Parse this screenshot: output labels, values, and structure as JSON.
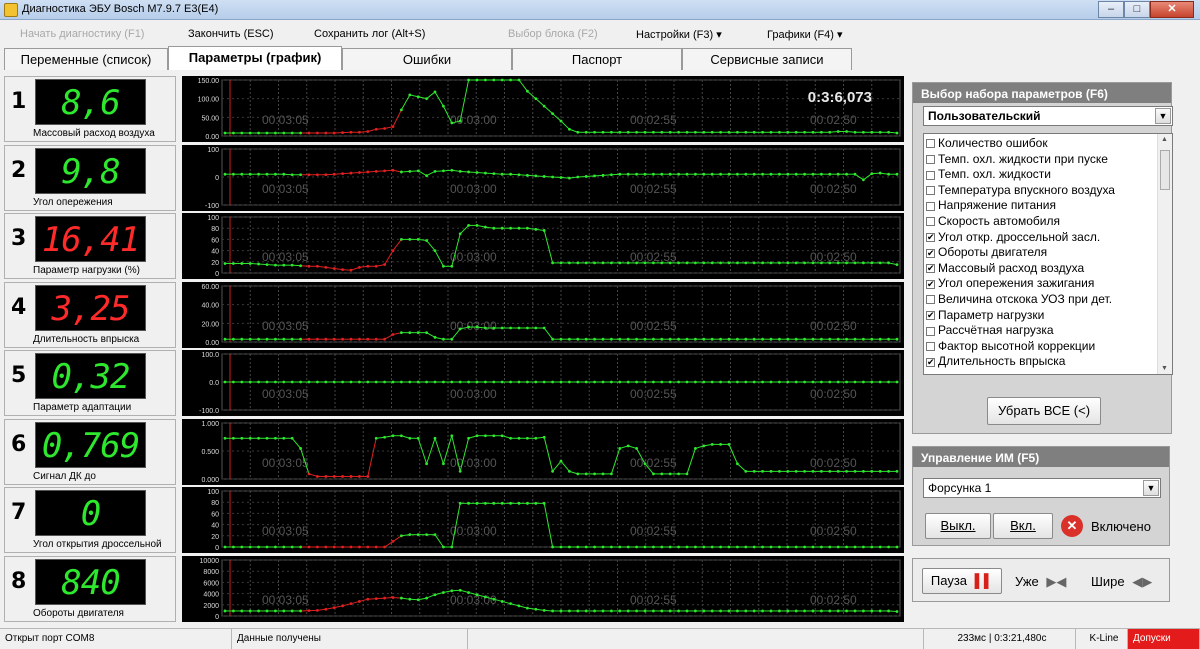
{
  "window": {
    "title": "Диагностика ЭБУ Bosch M7.9.7 E3(E4)",
    "min": "–",
    "max": "□",
    "close": "✕"
  },
  "menu": {
    "start": "Начать диагностику (F1)",
    "finish": "Закончить (ESC)",
    "save_log": "Сохранить лог (Alt+S)",
    "select_block": "Выбор блока (F2)",
    "settings": "Настройки (F3)",
    "graphs": "Графики (F4)"
  },
  "tabs": [
    "Переменные (список)",
    "Параметры (график)",
    "Ошибки",
    "Паспорт",
    "Сервисные записи"
  ],
  "active_tab": 1,
  "timer": "0:3:6,073",
  "gauges": [
    {
      "num": "1",
      "value": "8,6",
      "label": "Массовый расход воздуха",
      "color": "green"
    },
    {
      "num": "2",
      "value": "9,8",
      "label": "Угол опережения",
      "color": "green"
    },
    {
      "num": "3",
      "value": "16,41",
      "label": "Параметр нагрузки (%)",
      "color": "red"
    },
    {
      "num": "4",
      "value": "3,25",
      "label": "Длительность впрыска",
      "color": "red"
    },
    {
      "num": "5",
      "value": "0,32",
      "label": "Параметр адаптации",
      "color": "green"
    },
    {
      "num": "6",
      "value": "0,769",
      "label": "Сигнал ДК до",
      "color": "green"
    },
    {
      "num": "7",
      "value": "0",
      "label": "Угол открытия дроссельной",
      "color": "green"
    },
    {
      "num": "8",
      "value": "840",
      "label": "Обороты двигателя",
      "color": "green"
    }
  ],
  "chart_data": [
    {
      "type": "line",
      "yticks": [
        "150.00",
        "100.00",
        "50.00",
        "0.00"
      ],
      "ylim": [
        0,
        150
      ],
      "xticks": [
        "00:03:05",
        "00:03:00",
        "00:02:55",
        "00:02:50"
      ],
      "y": [
        8,
        8,
        8,
        8,
        8,
        8,
        8,
        8,
        8,
        8,
        8,
        8,
        8,
        8,
        9,
        10,
        10,
        12,
        18,
        20,
        25,
        70,
        110,
        105,
        100,
        118,
        80,
        35,
        40,
        160,
        160,
        160,
        160,
        160,
        160,
        150,
        120,
        100,
        80,
        60,
        40,
        18,
        10,
        10,
        10,
        10,
        10,
        10,
        10,
        10,
        10,
        10,
        10,
        10,
        10,
        10,
        10,
        10,
        10,
        10,
        10,
        10,
        10,
        10,
        10,
        10,
        10,
        10,
        10,
        10,
        10,
        10,
        10,
        12,
        12,
        10,
        10,
        10,
        10,
        10,
        8
      ]
    },
    {
      "type": "line",
      "yticks": [
        "100",
        "0",
        "-100"
      ],
      "ylim": [
        -100,
        100
      ],
      "xticks": [
        "00:03:05",
        "00:03:00",
        "00:02:55",
        "00:02:50"
      ],
      "y": [
        10,
        10,
        10,
        10,
        10,
        10,
        10,
        10,
        8,
        8,
        8,
        8,
        8,
        10,
        12,
        14,
        16,
        18,
        20,
        22,
        24,
        18,
        20,
        22,
        5,
        20,
        22,
        24,
        20,
        18,
        16,
        14,
        12,
        10,
        10,
        8,
        6,
        4,
        2,
        0,
        -2,
        -4,
        0,
        2,
        4,
        6,
        8,
        10,
        10,
        10,
        10,
        10,
        10,
        10,
        10,
        10,
        10,
        10,
        10,
        10,
        10,
        10,
        10,
        10,
        10,
        10,
        10,
        10,
        10,
        10,
        10,
        10,
        10,
        10,
        10,
        10,
        -10,
        12,
        14,
        10,
        10
      ]
    },
    {
      "type": "line",
      "yticks": [
        "100",
        "80",
        "60",
        "40",
        "20",
        "0"
      ],
      "ylim": [
        0,
        100
      ],
      "xticks": [
        "00:03:05",
        "00:03:00",
        "00:02:55",
        "00:02:50"
      ],
      "y": [
        17,
        17,
        17,
        17,
        16,
        15,
        14,
        14,
        14,
        13,
        12,
        12,
        10,
        8,
        6,
        5,
        10,
        12,
        12,
        15,
        40,
        60,
        60,
        60,
        58,
        40,
        12,
        12,
        70,
        85,
        85,
        82,
        80,
        80,
        80,
        80,
        80,
        78,
        76,
        18,
        18,
        18,
        18,
        18,
        18,
        18,
        18,
        18,
        18,
        18,
        18,
        18,
        18,
        18,
        18,
        18,
        18,
        18,
        18,
        18,
        18,
        18,
        18,
        18,
        18,
        18,
        18,
        18,
        18,
        18,
        18,
        18,
        18,
        18,
        18,
        18,
        18,
        18,
        18,
        18,
        15
      ]
    },
    {
      "type": "line",
      "yticks": [
        "60.00",
        "40.00",
        "20.00",
        "0.00"
      ],
      "ylim": [
        0,
        60
      ],
      "xticks": [
        "00:03:05",
        "00:03:00",
        "00:02:55",
        "00:02:50"
      ],
      "y": [
        3,
        3,
        3,
        3,
        3,
        3,
        3,
        3,
        3,
        3,
        3,
        3,
        3,
        3,
        3,
        3,
        3,
        3,
        3,
        3,
        8,
        10,
        10,
        10,
        10,
        5,
        3,
        3,
        14,
        16,
        16,
        15,
        15,
        15,
        15,
        15,
        15,
        15,
        15,
        3,
        3,
        3,
        3,
        3,
        3,
        3,
        3,
        3,
        3,
        3,
        3,
        3,
        3,
        3,
        3,
        3,
        3,
        3,
        3,
        3,
        3,
        3,
        3,
        3,
        3,
        3,
        3,
        3,
        3,
        3,
        3,
        3,
        3,
        3,
        3,
        3,
        3,
        3,
        3,
        3,
        3
      ]
    },
    {
      "type": "line",
      "yticks": [
        "100.0",
        "0.0",
        "-100.0"
      ],
      "ylim": [
        -100,
        100
      ],
      "xticks": [
        "00:03:05",
        "00:03:00",
        "00:02:55",
        "00:02:50"
      ],
      "y": [
        0,
        0,
        0,
        0,
        0,
        0,
        0,
        0,
        0,
        0,
        0,
        0,
        0,
        0,
        0,
        0,
        0,
        0,
        0,
        0,
        0,
        0,
        0,
        0,
        0,
        0,
        0,
        0,
        0,
        0,
        0,
        0,
        0,
        0,
        0,
        0,
        0,
        0,
        0,
        0,
        0,
        0,
        0,
        0,
        0,
        0,
        0,
        0,
        0,
        0,
        0,
        0,
        0,
        0,
        0,
        0,
        0,
        0,
        0,
        0,
        0,
        0,
        0,
        0,
        0,
        0,
        0,
        0,
        0,
        0,
        0,
        0,
        0,
        0,
        0,
        0,
        0,
        0,
        0,
        0,
        0
      ]
    },
    {
      "type": "line",
      "yticks": [
        "1.000",
        "0.500",
        "0.000"
      ],
      "ylim": [
        0,
        1.1
      ],
      "xticks": [
        "00:03:05",
        "00:03:00",
        "00:02:55",
        "00:02:50"
      ],
      "y": [
        0.8,
        0.8,
        0.8,
        0.8,
        0.8,
        0.8,
        0.8,
        0.8,
        0.8,
        0.6,
        0.1,
        0.05,
        0.05,
        0.05,
        0.05,
        0.05,
        0.05,
        0.05,
        0.8,
        0.82,
        0.85,
        0.85,
        0.8,
        0.8,
        0.3,
        0.8,
        0.3,
        0.85,
        0.15,
        0.8,
        0.85,
        0.85,
        0.85,
        0.85,
        0.8,
        0.8,
        0.8,
        0.8,
        0.82,
        0.15,
        0.35,
        0.15,
        0.1,
        0.1,
        0.1,
        0.1,
        0.1,
        0.6,
        0.65,
        0.6,
        0.3,
        0.1,
        0.1,
        0.1,
        0.1,
        0.1,
        0.6,
        0.65,
        0.68,
        0.68,
        0.68,
        0.3,
        0.15,
        0.15,
        0.15,
        0.15,
        0.15,
        0.15,
        0.15,
        0.15,
        0.15,
        0.15,
        0.15,
        0.15,
        0.15,
        0.15,
        0.15,
        0.15,
        0.15,
        0.15,
        0.15
      ]
    },
    {
      "type": "line",
      "yticks": [
        "100",
        "80",
        "60",
        "40",
        "20",
        "0"
      ],
      "ylim": [
        0,
        100
      ],
      "xticks": [
        "00:03:05",
        "00:03:00",
        "00:02:55",
        "00:02:50"
      ],
      "y": [
        0,
        0,
        0,
        0,
        0,
        0,
        0,
        0,
        0,
        0,
        0,
        0,
        0,
        0,
        0,
        0,
        0,
        0,
        0,
        0,
        10,
        20,
        22,
        22,
        22,
        22,
        0,
        0,
        78,
        78,
        78,
        78,
        78,
        78,
        78,
        78,
        78,
        78,
        78,
        0,
        0,
        0,
        0,
        0,
        0,
        0,
        0,
        0,
        0,
        0,
        0,
        0,
        0,
        0,
        0,
        0,
        0,
        0,
        0,
        0,
        0,
        0,
        0,
        0,
        0,
        0,
        0,
        0,
        0,
        0,
        0,
        0,
        0,
        0,
        0,
        0,
        0,
        0,
        0,
        0,
        0
      ]
    },
    {
      "type": "line",
      "yticks": [
        "10000",
        "8000",
        "6000",
        "4000",
        "2000",
        "0"
      ],
      "ylim": [
        0,
        10000
      ],
      "xticks": [
        "00:03:05",
        "00:03:00",
        "00:02:55",
        "00:02:50"
      ],
      "y": [
        900,
        900,
        900,
        900,
        900,
        900,
        900,
        900,
        900,
        900,
        950,
        1000,
        1200,
        1500,
        1800,
        2200,
        2600,
        3000,
        3100,
        3200,
        3300,
        3200,
        3000,
        2900,
        3200,
        3800,
        4200,
        4500,
        4600,
        4200,
        3800,
        3400,
        3000,
        2600,
        2200,
        1800,
        1400,
        1200,
        1000,
        900,
        900,
        900,
        900,
        900,
        900,
        900,
        900,
        900,
        900,
        900,
        900,
        900,
        900,
        900,
        900,
        900,
        900,
        900,
        900,
        900,
        900,
        900,
        900,
        900,
        900,
        900,
        900,
        900,
        900,
        900,
        900,
        900,
        900,
        900,
        900,
        900,
        900,
        900,
        900,
        900,
        800
      ]
    }
  ],
  "param_panel": {
    "title": "Выбор набора параметров (F6)",
    "preset": "Пользовательский",
    "items": [
      {
        "label": "Количество ошибок",
        "checked": false
      },
      {
        "label": "Темп. охл. жидкости при пуске",
        "checked": false
      },
      {
        "label": "Темп. охл. жидкости",
        "checked": false
      },
      {
        "label": "Температура впускного воздуха",
        "checked": false
      },
      {
        "label": "Напряжение питания",
        "checked": false
      },
      {
        "label": "Скорость автомобиля",
        "checked": false
      },
      {
        "label": "Угол откр. дроссельной засл.",
        "checked": true
      },
      {
        "label": "Обороты двигателя",
        "checked": true
      },
      {
        "label": "Массовый расход воздуха",
        "checked": true
      },
      {
        "label": "Угол опережения зажигания",
        "checked": true
      },
      {
        "label": "Величина отскока УОЗ при дет.",
        "checked": false
      },
      {
        "label": "Параметр нагрузки",
        "checked": true
      },
      {
        "label": "Рассчётная нагрузка",
        "checked": false
      },
      {
        "label": "Фактор высотной коррекции",
        "checked": false
      },
      {
        "label": "Длительность впрыска",
        "checked": true
      }
    ],
    "remove_all": "Убрать ВСЕ (<)"
  },
  "im_panel": {
    "title": "Управление ИМ (F5)",
    "device": "Форсунка 1",
    "off": "Выкл.",
    "on": "Вкл.",
    "state": "Включено"
  },
  "playback": {
    "pause": "Пауза",
    "narrow": "Уже",
    "wider": "Шире"
  },
  "status": {
    "port": "Открыт порт COM8",
    "data": "Данные получены",
    "timing": "233мс | 0:3:21,480с",
    "line": "K-Line",
    "tolerance": "Допуски"
  },
  "colors": {
    "trace_green": "#2ee82e",
    "trace_red": "#e02020",
    "lcd_bg": "#000000",
    "danger": "#e31b1b"
  }
}
